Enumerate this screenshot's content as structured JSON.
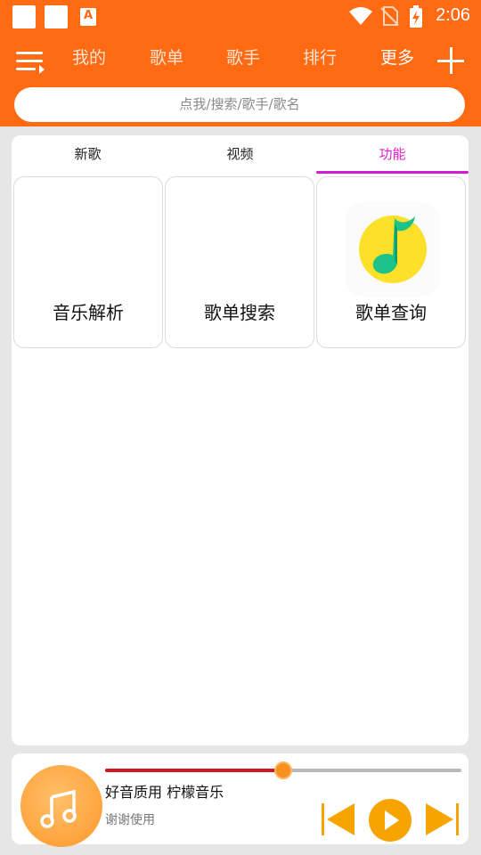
{
  "status_bar": {
    "time": "2:06",
    "icons": [
      "notification-square-icon",
      "notification-square-icon",
      "font-a-icon",
      "wifi-icon",
      "no-sim-icon",
      "battery-charging-icon"
    ]
  },
  "header": {
    "menu_icon": "menu-list-icon",
    "nav": [
      {
        "label": "我的"
      },
      {
        "label": "歌单"
      },
      {
        "label": "歌手"
      },
      {
        "label": "排行"
      },
      {
        "label": "更多"
      }
    ],
    "active_nav": "更多",
    "add_icon": "plus-icon",
    "a_glyph": "A",
    "search_placeholder": "点我/搜索/歌手/歌名"
  },
  "tabs": [
    {
      "label": "新歌"
    },
    {
      "label": "视频"
    },
    {
      "label": "功能"
    }
  ],
  "active_tab": "功能",
  "functions": [
    {
      "label": "音乐解析",
      "icon": ""
    },
    {
      "label": "歌单搜索",
      "icon": ""
    },
    {
      "label": "歌单查询",
      "icon": "qq-music-note-icon"
    }
  ],
  "player": {
    "cover_icon": "music-notes-icon",
    "title": "好音质用 柠檬音乐",
    "subtitle": "谢谢使用",
    "progress": 0.5,
    "controls": [
      "previous-icon",
      "play-icon",
      "next-icon"
    ]
  },
  "colors": {
    "primary": "#ff6a13",
    "tab_active": "#d21bd3",
    "progress": "#d2181f",
    "thumb": "#f7901e",
    "control": "#f7a300"
  }
}
